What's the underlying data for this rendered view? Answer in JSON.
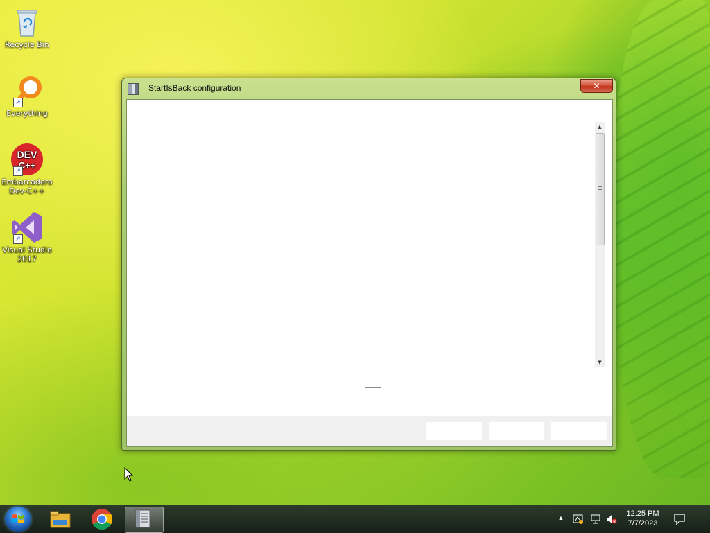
{
  "desktop": {
    "icons": [
      {
        "label_line1": "Recycle Bin",
        "label_line2": ""
      },
      {
        "label_line1": "Everything",
        "label_line2": ""
      },
      {
        "label_line1": "Embarcadero",
        "label_line2": "Dev-C++",
        "logo_text": "DEV",
        "logo_subtext": "C++"
      },
      {
        "label_line1": "Visual Studio",
        "label_line2": "2017"
      }
    ]
  },
  "window": {
    "title": "StartIsBack configuration",
    "close_glyph": "✕",
    "checkbox_checked": false
  },
  "taskbar": {
    "items": [
      "start-orb",
      "file-explorer-icon",
      "chrome-icon",
      "startisback-config-icon"
    ],
    "active_item": "startisback-config-icon"
  },
  "tray": {
    "overflow_glyph": "▲",
    "time": "12:25 PM",
    "date": "7/7/2023"
  },
  "colors": {
    "accent_taskbar": "#1f2a1f",
    "window_frame": "#a9cc73",
    "close_button": "#c9442b"
  }
}
